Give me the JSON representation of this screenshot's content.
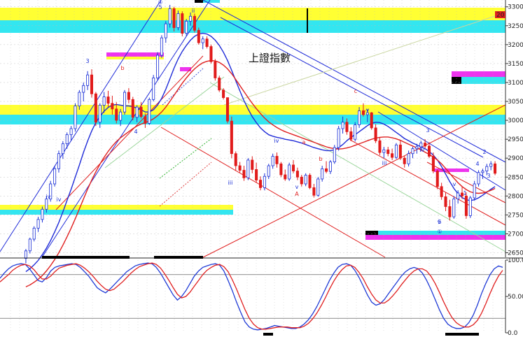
{
  "title": "上證指數",
  "colors": {
    "background": "#ffffff",
    "upCandle": "#1a2fd6",
    "downCandle": "#e11b1b",
    "maFast": "#1f2bd8",
    "maSlow": "#e02020",
    "stochK": "#1f3ad6",
    "stochD": "#e02020",
    "yellowBand": "#ffff33",
    "cyanBand": "#33e6f0",
    "magentaBand": "#ee33ee",
    "trendBlue": "#1f2bd8",
    "trendRed": "#e02020",
    "gridGray": "#b8b8b8"
  },
  "chart_data": [
    {
      "type": "candlestick",
      "title": "上證指數",
      "yticks": [
        "3300",
        "3250",
        "3200",
        "3150",
        "3100",
        "3050",
        "3000",
        "2950",
        "2900",
        "2850",
        "2800",
        "2750",
        "2700",
        "2650"
      ],
      "ylim": [
        2638,
        3318
      ],
      "grid": true,
      "current_marker": "20",
      "candles": [
        [
          2635,
          2660,
          2622,
          2655
        ],
        [
          2655,
          2690,
          2648,
          2686
        ],
        [
          2686,
          2720,
          2680,
          2715
        ],
        [
          2715,
          2745,
          2705,
          2738
        ],
        [
          2738,
          2772,
          2730,
          2765
        ],
        [
          2765,
          2800,
          2756,
          2792
        ],
        [
          2792,
          2840,
          2785,
          2832
        ],
        [
          2832,
          2880,
          2825,
          2872
        ],
        [
          2872,
          2920,
          2862,
          2912
        ],
        [
          2912,
          2945,
          2898,
          2938
        ],
        [
          2938,
          2968,
          2925,
          2962
        ],
        [
          2962,
          2985,
          2945,
          2978
        ],
        [
          2978,
          3045,
          2970,
          3038
        ],
        [
          3038,
          3080,
          3028,
          3074
        ],
        [
          3074,
          3100,
          3050,
          3092
        ],
        [
          3092,
          3130,
          3080,
          3120
        ],
        [
          3120,
          3135,
          3060,
          3070
        ],
        [
          3070,
          3075,
          2985,
          2995
        ],
        [
          2995,
          3045,
          2980,
          3040
        ],
        [
          3040,
          3075,
          3020,
          3062
        ],
        [
          3062,
          3078,
          3035,
          3045
        ],
        [
          3045,
          3065,
          3015,
          3030
        ],
        [
          3030,
          3048,
          2992,
          3000
        ],
        [
          3000,
          3030,
          2985,
          3022
        ],
        [
          3022,
          3080,
          3015,
          3074
        ],
        [
          3074,
          3085,
          3045,
          3055
        ],
        [
          3055,
          3062,
          3000,
          3008
        ],
        [
          3008,
          3040,
          2995,
          3035
        ],
        [
          3035,
          3048,
          3005,
          3010
        ],
        [
          3010,
          3018,
          2980,
          2992
        ],
        [
          2992,
          3060,
          2988,
          3055
        ],
        [
          3055,
          3120,
          3050,
          3112
        ],
        [
          3112,
          3180,
          3105,
          3172
        ],
        [
          3172,
          3225,
          3165,
          3218
        ],
        [
          3218,
          3262,
          3205,
          3255
        ],
        [
          3255,
          3305,
          3245,
          3295
        ],
        [
          3295,
          3300,
          3235,
          3245
        ],
        [
          3245,
          3290,
          3238,
          3282
        ],
        [
          3282,
          3288,
          3222,
          3230
        ],
        [
          3230,
          3268,
          3222,
          3262
        ],
        [
          3262,
          3285,
          3250,
          3275
        ],
        [
          3275,
          3282,
          3232,
          3238
        ],
        [
          3238,
          3245,
          3200,
          3205
        ],
        [
          3205,
          3222,
          3188,
          3215
        ],
        [
          3215,
          3222,
          3190,
          3195
        ],
        [
          3195,
          3200,
          3150,
          3155
        ],
        [
          3155,
          3162,
          3105,
          3112
        ],
        [
          3112,
          3118,
          3075,
          3080
        ],
        [
          3080,
          3085,
          3055,
          3060
        ],
        [
          3060,
          3060,
          2992,
          2998
        ],
        [
          2998,
          3010,
          2900,
          2912
        ],
        [
          2912,
          2918,
          2868,
          2880
        ],
        [
          2880,
          2890,
          2862,
          2868
        ],
        [
          2868,
          2880,
          2840,
          2848
        ],
        [
          2848,
          2900,
          2842,
          2895
        ],
        [
          2895,
          2905,
          2860,
          2870
        ],
        [
          2870,
          2888,
          2835,
          2842
        ],
        [
          2842,
          2852,
          2815,
          2822
        ],
        [
          2822,
          2860,
          2815,
          2852
        ],
        [
          2852,
          2885,
          2845,
          2880
        ],
        [
          2880,
          2912,
          2872,
          2905
        ],
        [
          2905,
          2915,
          2875,
          2885
        ],
        [
          2885,
          2890,
          2850,
          2856
        ],
        [
          2856,
          2870,
          2840,
          2845
        ],
        [
          2845,
          2888,
          2840,
          2882
        ],
        [
          2882,
          2895,
          2860,
          2866
        ],
        [
          2866,
          2875,
          2842,
          2850
        ],
        [
          2850,
          2856,
          2825,
          2832
        ],
        [
          2832,
          2860,
          2826,
          2855
        ],
        [
          2855,
          2860,
          2818,
          2822
        ],
        [
          2822,
          2832,
          2796,
          2802
        ],
        [
          2802,
          2850,
          2798,
          2845
        ],
        [
          2845,
          2880,
          2838,
          2872
        ],
        [
          2872,
          2892,
          2860,
          2865
        ],
        [
          2865,
          2895,
          2858,
          2890
        ],
        [
          2890,
          2935,
          2885,
          2928
        ],
        [
          2928,
          2985,
          2920,
          2978
        ],
        [
          2978,
          3010,
          2965,
          2995
        ],
        [
          2995,
          3005,
          2962,
          2970
        ],
        [
          2970,
          2982,
          2945,
          2950
        ],
        [
          2950,
          2995,
          2944,
          2988
        ],
        [
          2988,
          3035,
          2980,
          3025
        ],
        [
          3025,
          3045,
          3010,
          3015
        ],
        [
          3015,
          3030,
          2995,
          3020
        ],
        [
          3020,
          3022,
          2975,
          2980
        ],
        [
          2980,
          2990,
          2940,
          2946
        ],
        [
          2946,
          2955,
          2908,
          2915
        ],
        [
          2915,
          2930,
          2900,
          2922
        ],
        [
          2922,
          2930,
          2905,
          2912
        ],
        [
          2912,
          2925,
          2895,
          2902
        ],
        [
          2902,
          2940,
          2898,
          2935
        ],
        [
          2935,
          2948,
          2895,
          2900
        ],
        [
          2900,
          2906,
          2875,
          2885
        ],
        [
          2885,
          2920,
          2878,
          2912
        ],
        [
          2912,
          2930,
          2900,
          2925
        ],
        [
          2925,
          2938,
          2912,
          2930
        ],
        [
          2930,
          2946,
          2918,
          2940
        ],
        [
          2940,
          2950,
          2926,
          2932
        ],
        [
          2932,
          2942,
          2900,
          2905
        ],
        [
          2905,
          2915,
          2860,
          2866
        ],
        [
          2866,
          2870,
          2818,
          2825
        ],
        [
          2825,
          2835,
          2790,
          2798
        ],
        [
          2798,
          2810,
          2760,
          2772
        ],
        [
          2772,
          2790,
          2735,
          2745
        ],
        [
          2745,
          2800,
          2740,
          2792
        ],
        [
          2792,
          2815,
          2780,
          2808
        ],
        [
          2808,
          2825,
          2792,
          2800
        ],
        [
          2800,
          2810,
          2740,
          2748
        ],
        [
          2748,
          2800,
          2742,
          2795
        ],
        [
          2795,
          2840,
          2788,
          2832
        ],
        [
          2832,
          2868,
          2825,
          2862
        ],
        [
          2862,
          2872,
          2845,
          2866
        ],
        [
          2866,
          2885,
          2855,
          2878
        ],
        [
          2878,
          2892,
          2868,
          2885
        ],
        [
          2885,
          2892,
          2855,
          2860
        ]
      ],
      "series": [
        {
          "name": "",
          "values": [
            2600,
            2608,
            2618,
            2630,
            2645,
            2662,
            2682,
            2705,
            2730,
            2758,
            2788,
            2818,
            2850,
            2882,
            2915,
            2945,
            2972,
            2994,
            3010,
            3024,
            3034,
            3040,
            3042,
            3040,
            3038,
            3038,
            3036,
            3032,
            3028,
            3022,
            3022,
            3028,
            3040,
            3058,
            3082,
            3110,
            3138,
            3162,
            3182,
            3198,
            3212,
            3222,
            3228,
            3230,
            3228,
            3222,
            3212,
            3198,
            3180,
            3158,
            3132,
            3105,
            3078,
            3052,
            3030,
            3010,
            2994,
            2980,
            2970,
            2962,
            2958,
            2955,
            2953,
            2950,
            2948,
            2946,
            2943,
            2940,
            2936,
            2932,
            2928,
            2925,
            2922,
            2920,
            2920,
            2922,
            2928,
            2936,
            2946,
            2955,
            2962,
            2970,
            2978,
            2986,
            2992,
            2995,
            2994,
            2990,
            2984,
            2976,
            2968,
            2960,
            2952,
            2946,
            2940,
            2935,
            2930,
            2925,
            2918,
            2908,
            2895,
            2878,
            2858,
            2838,
            2820,
            2806,
            2796,
            2790,
            2788,
            2790,
            2795,
            2802,
            2810,
            2818,
            2825
          ]
        },
        {
          "name": "",
          "values": [
            2560,
            2565,
            2572,
            2580,
            2590,
            2602,
            2616,
            2632,
            2650,
            2670,
            2692,
            2715,
            2740,
            2766,
            2792,
            2818,
            2842,
            2864,
            2884,
            2902,
            2918,
            2932,
            2944,
            2954,
            2962,
            2970,
            2978,
            2985,
            2990,
            2994,
            2998,
            3004,
            3012,
            3022,
            3035,
            3050,
            3066,
            3082,
            3098,
            3112,
            3125,
            3136,
            3145,
            3152,
            3156,
            3158,
            3157,
            3153,
            3146,
            3136,
            3123,
            3108,
            3092,
            3076,
            3060,
            3045,
            3031,
            3018,
            3006,
            2996,
            2988,
            2981,
            2975,
            2970,
            2966,
            2962,
            2958,
            2954,
            2950,
            2946,
            2942,
            2938,
            2934,
            2930,
            2927,
            2925,
            2924,
            2925,
            2927,
            2930,
            2934,
            2938,
            2942,
            2946,
            2950,
            2953,
            2955,
            2956,
            2956,
            2954,
            2951,
            2947,
            2942,
            2937,
            2932,
            2927,
            2922,
            2916,
            2910,
            2903,
            2895,
            2885,
            2873,
            2860,
            2847,
            2835,
            2825,
            2817,
            2811,
            2808,
            2807,
            2808,
            2811,
            2815,
            2820
          ]
        }
      ],
      "annotations": [
        "3",
        "5",
        "ii",
        "b",
        "4",
        "iii",
        "iv",
        "v",
        "3",
        "iv",
        "v",
        "a",
        "b",
        "A",
        "c",
        "v",
        "iii",
        "iv",
        "v",
        "1",
        "2",
        "3",
        "4",
        "5",
        "v",
        "①",
        "④",
        "iv"
      ]
    },
    {
      "type": "line",
      "ylim": [
        0,
        100
      ],
      "yticks": [
        "100.0",
        "50.00",
        "0.0"
      ],
      "series": [
        {
          "name": "",
          "values": [
            75,
            82,
            88,
            92,
            94,
            95,
            94,
            88,
            80,
            72,
            70,
            76,
            85,
            90,
            92,
            93,
            94,
            95,
            94,
            90,
            84,
            78,
            70,
            62,
            58,
            55,
            60,
            66,
            72,
            78,
            84,
            88,
            92,
            94,
            95,
            96,
            95,
            90,
            82,
            72,
            62,
            52,
            45,
            50,
            58,
            68,
            78,
            85,
            90,
            92,
            94,
            95,
            93,
            85,
            72,
            58,
            42,
            28,
            15,
            8,
            5,
            4,
            5,
            6,
            8,
            10,
            9,
            8,
            7,
            6,
            6,
            8,
            12,
            18,
            26,
            36,
            48,
            60,
            72,
            82,
            90,
            94,
            95,
            93,
            86,
            76,
            64,
            52,
            42,
            38,
            40,
            46,
            54,
            62,
            70,
            78,
            84,
            88,
            90,
            88,
            82,
            72,
            60,
            46,
            32,
            20,
            12,
            8,
            6,
            6,
            8,
            14,
            24,
            38,
            54,
            68,
            80,
            88,
            92,
            90
          ]
        },
        {
          "name": "",
          "values": [
            70,
            75,
            80,
            86,
            90,
            93,
            94,
            92,
            87,
            80,
            74,
            74,
            78,
            84,
            89,
            91,
            93,
            94,
            95,
            93,
            89,
            84,
            78,
            71,
            65,
            60,
            58,
            60,
            65,
            70,
            76,
            82,
            87,
            91,
            93,
            95,
            96,
            94,
            89,
            81,
            72,
            62,
            53,
            48,
            50,
            56,
            64,
            72,
            80,
            86,
            90,
            93,
            94,
            91,
            84,
            73,
            60,
            46,
            32,
            20,
            12,
            7,
            5,
            5,
            6,
            7,
            8,
            8,
            8,
            7,
            7,
            7,
            9,
            13,
            19,
            27,
            37,
            48,
            60,
            71,
            80,
            87,
            92,
            93,
            90,
            83,
            74,
            63,
            53,
            45,
            41,
            41,
            45,
            51,
            58,
            66,
            73,
            80,
            85,
            88,
            88,
            85,
            78,
            68,
            56,
            43,
            31,
            21,
            14,
            10,
            8,
            8,
            11,
            17,
            27,
            40,
            54,
            67,
            78,
            86
          ]
        }
      ]
    }
  ]
}
